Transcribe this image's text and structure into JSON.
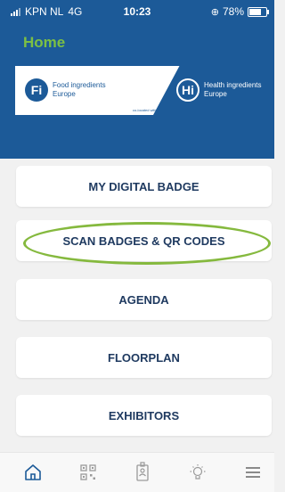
{
  "status_bar": {
    "carrier": "KPN NL",
    "network": "4G",
    "time": "10:23",
    "battery_percent": "78%",
    "battery_level": 0.78
  },
  "header": {
    "title": "Home",
    "accent_color": "#7cc043",
    "background_color": "#1c5a98"
  },
  "banner": {
    "fi_logo": {
      "mark": "Fi",
      "line1": "Food ingredients",
      "line2": "Europe"
    },
    "hi_logo": {
      "mark": "Hi",
      "line1": "Health ingredients",
      "line2": "Europe"
    },
    "co_located": "co-located with"
  },
  "menu": [
    {
      "label": "MY DIGITAL BADGE"
    },
    {
      "label": "SCAN BADGES & QR CODES",
      "highlighted": true,
      "highlight_color": "#85b93e"
    },
    {
      "label": "AGENDA"
    },
    {
      "label": "FLOORPLAN"
    },
    {
      "label": "EXHIBITORS"
    }
  ],
  "tabbar": {
    "icons": [
      "home-icon",
      "qr-code-icon",
      "badge-icon",
      "lightbulb-icon",
      "menu-icon"
    ],
    "active_color": "#1c5a98"
  }
}
